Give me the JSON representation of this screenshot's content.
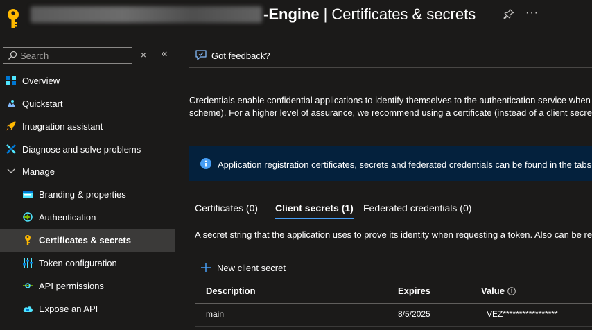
{
  "header": {
    "title_suffix": "-Engine",
    "title_separator": "|",
    "title_page": "Certificates & secrets",
    "more_label": "···"
  },
  "sidebar": {
    "search_placeholder": "Search",
    "clear_label": "×",
    "collapse_label": "«",
    "items": [
      {
        "label": "Overview",
        "icon": "overview-icon",
        "level": "top"
      },
      {
        "label": "Quickstart",
        "icon": "quickstart-cloud-icon",
        "level": "top"
      },
      {
        "label": "Integration assistant",
        "icon": "rocket-icon",
        "level": "top"
      },
      {
        "label": "Diagnose and solve problems",
        "icon": "wrench-icon",
        "level": "top"
      },
      {
        "label": "Manage",
        "icon": "chevron-down-icon",
        "level": "top"
      },
      {
        "label": "Branding & properties",
        "icon": "branding-icon",
        "level": "sub"
      },
      {
        "label": "Authentication",
        "icon": "authentication-icon",
        "level": "sub"
      },
      {
        "label": "Certificates & secrets",
        "icon": "key-icon",
        "level": "sub",
        "selected": true
      },
      {
        "label": "Token configuration",
        "icon": "token-icon",
        "level": "sub"
      },
      {
        "label": "API permissions",
        "icon": "api-permissions-icon",
        "level": "sub"
      },
      {
        "label": "Expose an API",
        "icon": "cloud-api-icon",
        "level": "sub"
      }
    ]
  },
  "main": {
    "feedback_label": "Got feedback?",
    "intro_line1": "Credentials enable confidential applications to identify themselves to the authentication service when",
    "intro_line2": "scheme). For a higher level of assurance, we recommend using a certificate (instead of a client secret)",
    "info_text": "Application registration certificates, secrets and federated credentials can be found in the tabs",
    "tabs": [
      {
        "label": "Certificates (0)",
        "active": false
      },
      {
        "label": "Client secrets (1)",
        "active": true
      },
      {
        "label": "Federated credentials (0)",
        "active": false
      }
    ],
    "secret_description": "A secret string that the application uses to prove its identity when requesting a token. Also can be re",
    "new_secret_label": "New client secret",
    "table": {
      "headers": {
        "description": "Description",
        "expires": "Expires",
        "value": "Value"
      },
      "rows": [
        {
          "description": "main",
          "expires": "8/5/2025",
          "value": "VEZ*****************"
        }
      ]
    }
  },
  "colors": {
    "background": "#1b1a19",
    "selected_nav": "#3b3a39",
    "info_bar": "#04213d",
    "accent": "#479ef5",
    "key_yellow": "#ffb900"
  }
}
